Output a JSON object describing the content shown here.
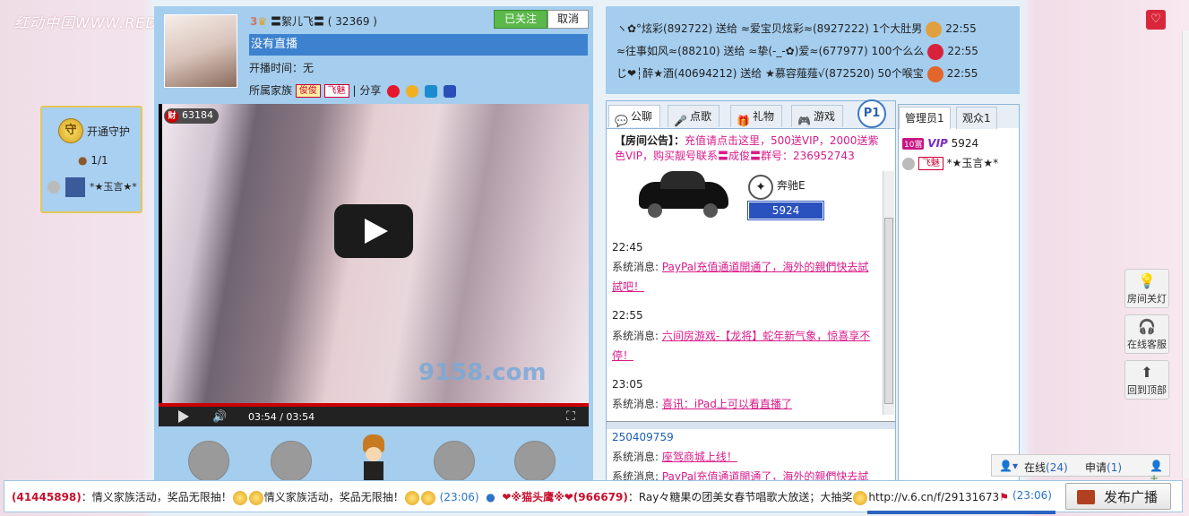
{
  "logo": "红动中国WWW.RED",
  "guard": {
    "badge": "守",
    "label": "开通守护",
    "count": "1/1",
    "user": "*★玉言★*"
  },
  "host": {
    "level": "3",
    "name": "〓絮儿飞〓",
    "id": "( 32369 )",
    "follow_label": "已关注",
    "cancel_label": "取消",
    "live_status": "没有直播",
    "start_time": "开播时间：无",
    "family_label": "所属家族",
    "tag1": "俊俊",
    "tag2": "飞魅",
    "share_label": "| 分享"
  },
  "video": {
    "viewers": "63184",
    "viewer_badge": "财",
    "watermark": "9158.com",
    "time": "03:54 / 03:54",
    "progress": 1.0
  },
  "gifts": [
    {
      "text": "ヽ✿°炫彩(892722) 送给 ≈爱宝贝炫彩≈(8927222) 1个大肚男",
      "time": "22:55",
      "color": "#e0a040"
    },
    {
      "text": "≈往事如风≈(88210) 送给 ≈挚(-_-✿)爱≈(677977) 100个么么",
      "time": "22:55",
      "color": "#d8223c"
    },
    {
      "text": "じ❤┆醉★酒(40694212) 送给 ★慕容薤薤√(872520) 50个喉宝",
      "time": "22:55",
      "color": "#e2662a"
    }
  ],
  "chat": {
    "tabs": [
      {
        "label": "公聊"
      },
      {
        "label": "点歌"
      },
      {
        "label": "礼物"
      },
      {
        "label": "游戏"
      }
    ],
    "p1": "P1",
    "notice_head": "【房间公告】：",
    "notice_body": "充值请点击这里，500送VIP，2000送紫色VIP，购买靓号联系〓成俊〓群号：236952743",
    "car_name": "奔驰E",
    "car_num": "5924",
    "messages": [
      {
        "time": "22:45",
        "prefix": "系统消息: ",
        "text": "PayPal充值通道開通了，海外的親們快去試試吧！"
      },
      {
        "time": "22:55",
        "prefix": "系统消息: ",
        "text": "六间房游戏-【龙将】蛇年新气象，惊喜享不停！"
      },
      {
        "time": "23:05",
        "prefix": "系统消息: ",
        "text": "喜讯：iPad上可以看直播了"
      }
    ],
    "sub_id": "250409759",
    "sub_messages": [
      {
        "prefix": "系统消息: ",
        "text": "座驾商城上线！"
      },
      {
        "prefix": "系统消息: ",
        "text": "PayPal充值通道開通了，海外的親們快去試"
      }
    ]
  },
  "users": {
    "tabs": [
      {
        "label": "管理员1"
      },
      {
        "label": "观众1"
      }
    ],
    "rows": [
      {
        "badge": "10富",
        "vip": "VIP",
        "name": "5924"
      },
      {
        "tag": "飞魅",
        "name": "*★玉言★*"
      }
    ]
  },
  "sidebar": {
    "heart": "♡",
    "lights": "房间关灯",
    "service": "在线客服",
    "top": "回到顶部"
  },
  "online": {
    "online_label": "在线",
    "online_count": "(24)",
    "apply_label": "申请",
    "apply_count": "(1)"
  },
  "bottom": {
    "id1": "(41445898)",
    "msg1": "：情义家族活动，奖品无限抽！",
    "msg1b": "情义家族活动，奖品无限抽！",
    "time1": "(23:06)",
    "name2": "❤※猫头鹰※❤(966679)",
    "msg2": "：Ray々糖果の团美女春节唱歌大放送；大抽奖",
    "url": "http://v.6.cn/f/29131673",
    "time2": "(23:06)",
    "broadcast_label": "发布广播"
  },
  "colors": {
    "panel": "#a4cdee",
    "accent": "#3d82ce",
    "pink_link": "#d81b8a",
    "follow": "#5bb84a"
  }
}
